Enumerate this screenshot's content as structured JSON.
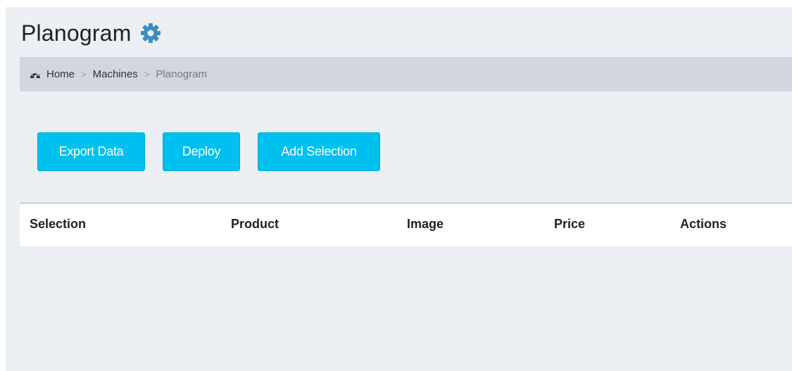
{
  "header": {
    "title": "Planogram",
    "settings_icon": "gear-icon",
    "accent_color": "#3c8dbc"
  },
  "breadcrumb": {
    "icon": "dashboard-icon",
    "items": [
      {
        "label": "Home"
      },
      {
        "label": "Machines"
      },
      {
        "label": "Planogram"
      }
    ],
    "separator": ">"
  },
  "toolbar": {
    "export_label": "Export Data",
    "deploy_label": "Deploy",
    "add_selection_label": "Add Selection",
    "button_color": "#00c0ef"
  },
  "table": {
    "columns": [
      "Selection",
      "Product",
      "Image",
      "Price",
      "Actions"
    ],
    "rows": []
  }
}
